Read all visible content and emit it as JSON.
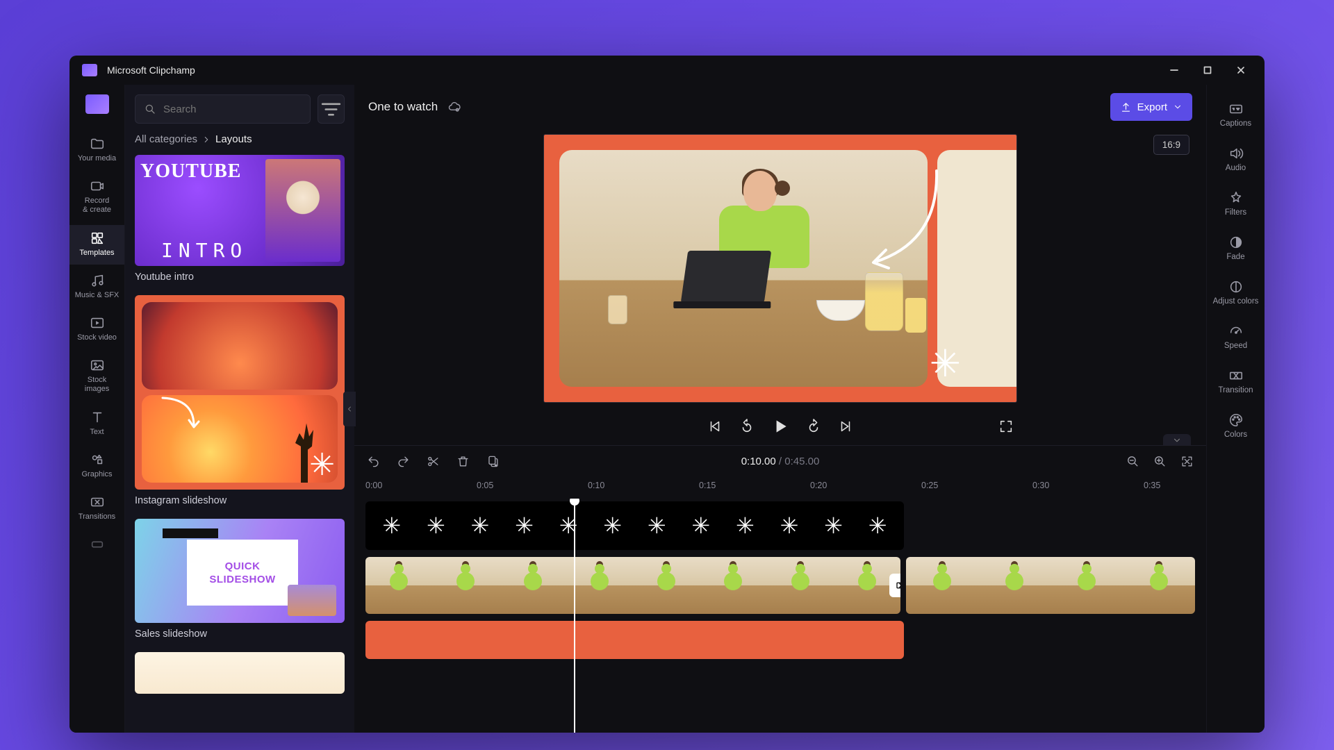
{
  "app_title": "Microsoft Clipchamp",
  "project_title": "One to watch",
  "export_label": "Export",
  "aspect_ratio": "16:9",
  "search": {
    "placeholder": "Search"
  },
  "breadcrumb": {
    "root": "All categories",
    "current": "Layouts"
  },
  "left_rail": {
    "your_media": "Your media",
    "record": "Record\n& create",
    "templates": "Templates",
    "music": "Music & SFX",
    "stock_video": "Stock video",
    "stock_images": "Stock\nimages",
    "text": "Text",
    "graphics": "Graphics",
    "transitions": "Transitions"
  },
  "templates": {
    "youtube": {
      "label": "Youtube intro",
      "line1": "YOUTUBE",
      "line2": "INTRO"
    },
    "instagram": {
      "label": "Instagram slideshow"
    },
    "sales": {
      "label": "Sales slideshow",
      "card_l1": "QUICK",
      "card_l2": "SLIDESHOW"
    }
  },
  "right_rail": {
    "captions": "Captions",
    "audio": "Audio",
    "filters": "Filters",
    "fade": "Fade",
    "adjust": "Adjust colors",
    "speed": "Speed",
    "transition": "Transition",
    "colors": "Colors"
  },
  "timeline": {
    "current": "0:10.00",
    "separator": " / ",
    "duration": "0:45.00",
    "ticks": [
      "0:00",
      "0:05",
      "0:10",
      "0:15",
      "0:20",
      "0:25",
      "0:30",
      "0:35"
    ]
  }
}
